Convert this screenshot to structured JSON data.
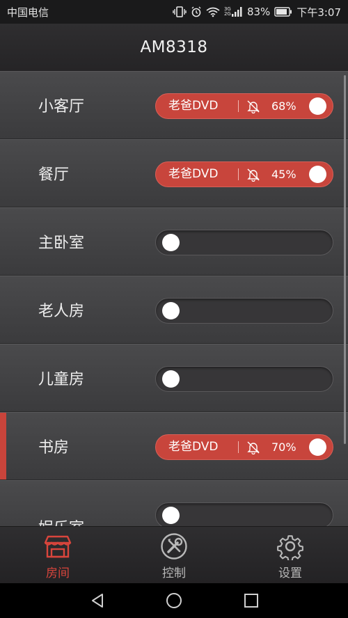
{
  "status_bar": {
    "carrier": "中国电信",
    "network": "3G 2G",
    "battery": "83%",
    "time": "下午3:07"
  },
  "header": {
    "title": "AM8318"
  },
  "rooms": [
    {
      "name": "小客厅",
      "on": true,
      "source": "老爸DVD",
      "volume": "68%"
    },
    {
      "name": "餐厅",
      "on": true,
      "source": "老爸DVD",
      "volume": "45%"
    },
    {
      "name": "主卧室",
      "on": false
    },
    {
      "name": "老人房",
      "on": false
    },
    {
      "name": "儿童房",
      "on": false
    },
    {
      "name": "书房",
      "on": true,
      "source": "老爸DVD",
      "volume": "70%",
      "selected": true
    },
    {
      "name": "娱乐室",
      "on": false
    }
  ],
  "tabs": [
    {
      "label": "房间",
      "icon": "store-icon",
      "active": true
    },
    {
      "label": "控制",
      "icon": "tools-icon",
      "active": false
    },
    {
      "label": "设置",
      "icon": "gear-icon",
      "active": false
    }
  ],
  "colors": {
    "accent": "#c8453c",
    "tab_active": "#d9453c",
    "tab_inactive": "#b9b9b9"
  }
}
